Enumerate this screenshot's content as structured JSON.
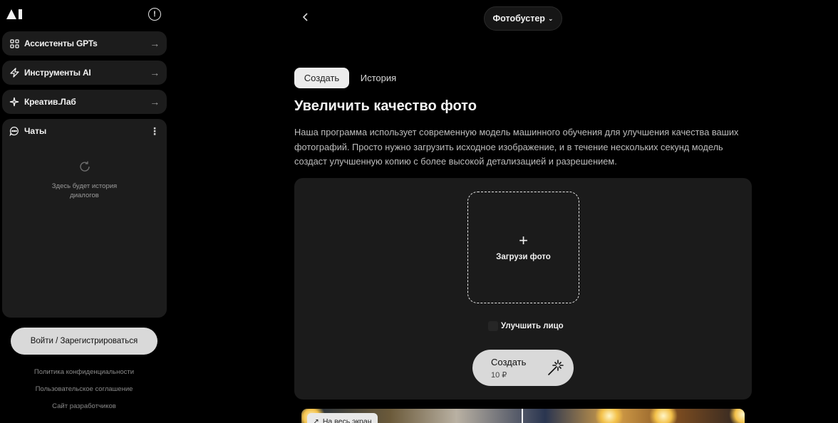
{
  "app": {
    "logo_alt": "AI"
  },
  "sidebar": {
    "items": [
      {
        "label": "Ассистенты GPTs",
        "icon": "grid-icon"
      },
      {
        "label": "Инструменты AI",
        "icon": "lightning-icon"
      },
      {
        "label": "Креатив.Лаб",
        "icon": "sparkle-icon"
      }
    ],
    "chats": {
      "label": "Чаты",
      "empty_text": "Здесь будет история диалогов"
    },
    "login_label": "Войти / Зарегистрироваться",
    "footer_links": [
      "Политика конфиденциальности",
      "Пользовательское соглашение",
      "Сайт разработчиков"
    ]
  },
  "header": {
    "model_name": "Фотобустер"
  },
  "tabs": {
    "create": "Создать",
    "history": "История"
  },
  "main": {
    "title": "Увеличить качество фото",
    "description": "Наша программа использует современную модель машинного обучения для улучшения качества ваших фотографий. Просто нужно загрузить исходное изображение, и в течение нескольких секунд модель создаст улучшенную копию с более высокой детализацией и разрешением.",
    "upload_label": "Загрузи фото",
    "face_option": "Улучшить лицо",
    "face_checked": false,
    "create_button": {
      "label": "Создать",
      "price": "10 ₽"
    },
    "preview": {
      "fullscreen_label": "На весь экран"
    }
  },
  "colors": {
    "background": "#000000",
    "panel": "#1b1b1b",
    "sidebar_card": "#1c1c1c",
    "button_light": "#d9d9d9"
  }
}
